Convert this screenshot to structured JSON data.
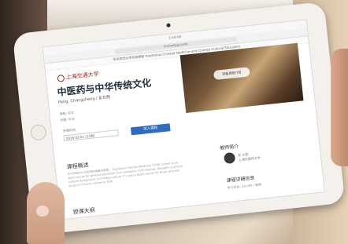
{
  "browser": {
    "status": "2:49 PM",
    "url": "m.lovelyip.com",
    "topnav": "华东师范大学开放课程 Traditional Chinese Medicine and Chinese Cultural Education"
  },
  "page": {
    "logo_text": "上海交通大学",
    "course_title": "中医药与中华传统文化",
    "author": "Peng, Changsheng / 彭长胜",
    "meta_1": "课程: 中文",
    "meta_2": "学期: 中文",
    "enroll_label": "开课时间",
    "date_value": "2016-03-01 (22周)",
    "enroll_button": "加入课程",
    "hero_overlay": "观看课程介绍",
    "overview_heading": "课程概述",
    "overview_text": "中华传统文化中医药的精髓与智慧... Traditional Chinese Medicine (TCM) culture is an open course for general education that introduces TCM theories, thoughts and their cultural background in Chinese culture. It's also a basic course for those who will study in Chinese culture or TCM.",
    "syllabus_heading": "授课大纲",
    "teacher_heading": "教师简介",
    "teacher_name": "彭 长胜",
    "teacher_org": "上海中医药大学",
    "details_heading": "课程详细信息",
    "details_hint": "学习时长: 22小时 / 每周"
  }
}
